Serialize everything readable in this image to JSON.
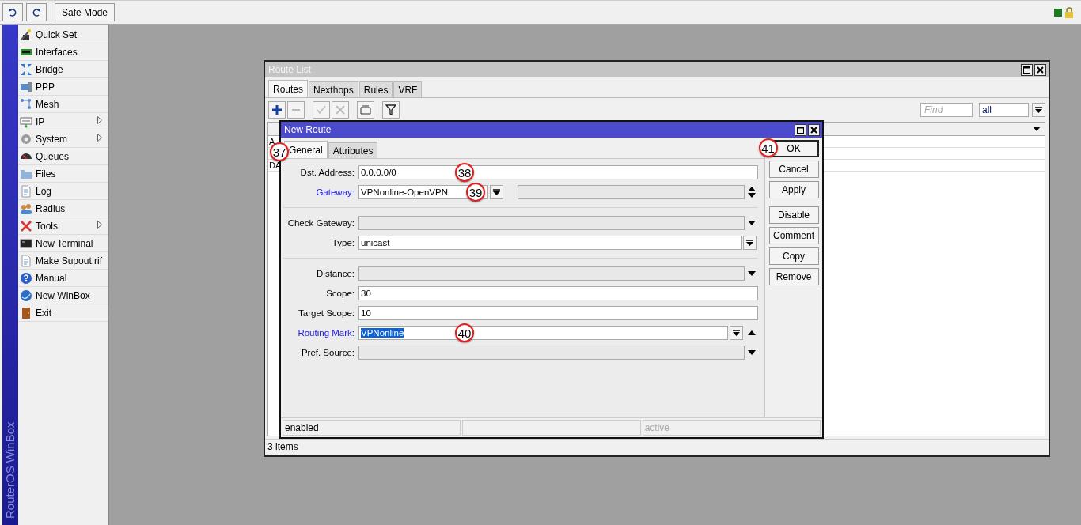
{
  "top_bar": {
    "safe_mode": "Safe Mode"
  },
  "sidebar": {
    "brand": "RouterOS WinBox",
    "items": [
      {
        "label": "Quick Set",
        "submenu": false
      },
      {
        "label": "Interfaces",
        "submenu": false
      },
      {
        "label": "Bridge",
        "submenu": false
      },
      {
        "label": "PPP",
        "submenu": false
      },
      {
        "label": "Mesh",
        "submenu": false
      },
      {
        "label": "IP",
        "submenu": true
      },
      {
        "label": "System",
        "submenu": true
      },
      {
        "label": "Queues",
        "submenu": false
      },
      {
        "label": "Files",
        "submenu": false
      },
      {
        "label": "Log",
        "submenu": false
      },
      {
        "label": "Radius",
        "submenu": false
      },
      {
        "label": "Tools",
        "submenu": true
      },
      {
        "label": "New Terminal",
        "submenu": false
      },
      {
        "label": "Make Supout.rif",
        "submenu": false
      },
      {
        "label": "Manual",
        "submenu": false
      },
      {
        "label": "New WinBox",
        "submenu": false
      },
      {
        "label": "Exit",
        "submenu": false
      }
    ]
  },
  "route_list": {
    "title": "Route List",
    "tabs": [
      {
        "label": "Routes",
        "selected": true
      },
      {
        "label": "Nexthops",
        "selected": false
      },
      {
        "label": "Rules",
        "selected": false
      },
      {
        "label": "VRF",
        "selected": false
      }
    ],
    "tools": [
      {
        "kind": "add",
        "disabled": false
      },
      {
        "kind": "remove",
        "disabled": true
      },
      {
        "kind": "enable",
        "disabled": true
      },
      {
        "kind": "disable",
        "disabled": true
      },
      {
        "kind": "comment",
        "disabled": false
      },
      {
        "kind": "filter",
        "disabled": false
      }
    ],
    "find_placeholder": "Find",
    "filter": "all",
    "rows": [
      "A",
      "DA"
    ],
    "status": "3 items"
  },
  "new_route": {
    "title": "New Route",
    "tabs": [
      {
        "label": "General",
        "selected": true,
        "callout": "37"
      },
      {
        "label": "Attributes",
        "selected": false
      }
    ],
    "fields": [
      {
        "label": "Dst. Address:",
        "kind": "text",
        "value": "0.0.0.0/0",
        "link": false,
        "section_start": false,
        "callout": "38"
      },
      {
        "label": "Gateway:",
        "kind": "gateway",
        "value": "VPNonline-OpenVPN",
        "link": true,
        "section_start": false,
        "callout": "39"
      },
      {
        "label": "Check Gateway:",
        "kind": "unset",
        "link": false,
        "section_start": true
      },
      {
        "label": "Type:",
        "kind": "combo",
        "value": "unicast",
        "link": false,
        "section_start": false
      },
      {
        "label": "Distance:",
        "kind": "unset",
        "link": false,
        "section_start": true
      },
      {
        "label": "Scope:",
        "kind": "text",
        "value": "30",
        "link": false,
        "section_start": false
      },
      {
        "label": "Target Scope:",
        "kind": "text",
        "value": "10",
        "link": false,
        "section_start": false
      },
      {
        "label": "Routing Mark:",
        "kind": "combo-up",
        "value": "VPNonline",
        "highlighted": true,
        "link": true,
        "section_start": false,
        "callout": "40"
      },
      {
        "label": "Pref. Source:",
        "kind": "unset",
        "link": false,
        "section_start": false
      }
    ],
    "button_groups": [
      [
        {
          "label": "OK",
          "callout": "41",
          "default": true
        },
        {
          "label": "Cancel",
          "default": false
        },
        {
          "label": "Apply",
          "default": false
        }
      ],
      [
        {
          "label": "Disable",
          "default": false
        },
        {
          "label": "Comment",
          "default": false
        },
        {
          "label": "Copy",
          "default": false
        },
        {
          "label": "Remove",
          "default": false
        }
      ]
    ],
    "status": {
      "left": "enabled",
      "right": "active"
    }
  }
}
